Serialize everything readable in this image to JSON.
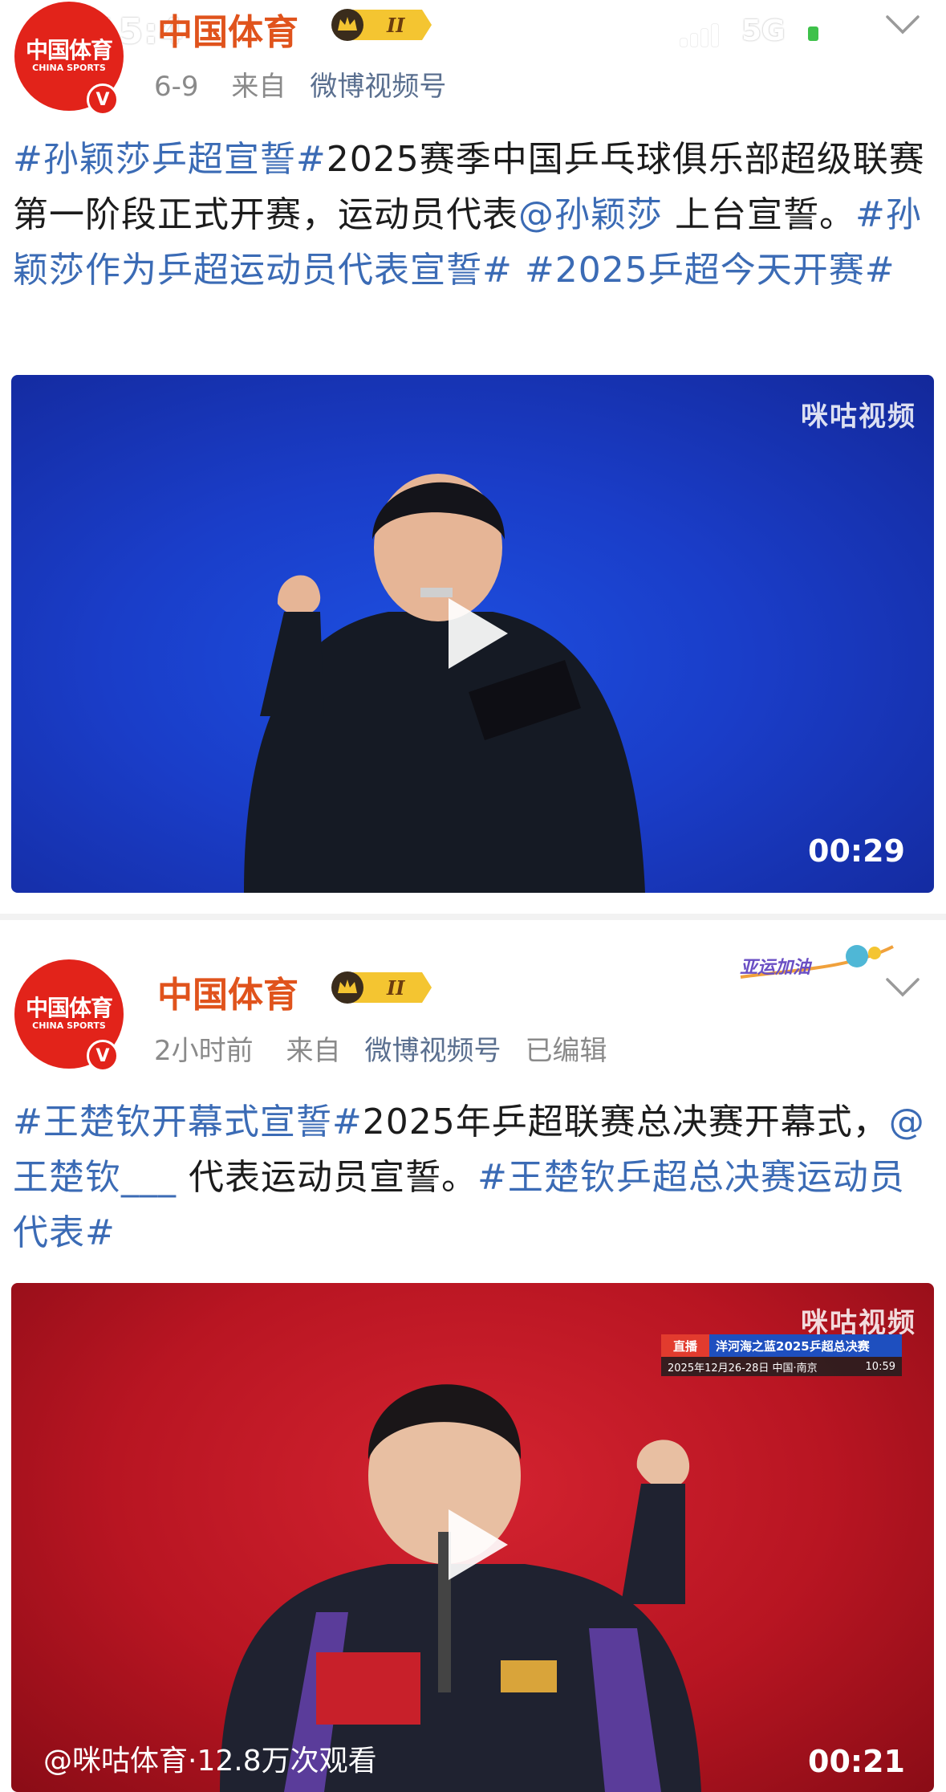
{
  "status_bar": {
    "time": "15:4",
    "network": "5G",
    "battery_level": 0.3
  },
  "posts": [
    {
      "account_name": "中国体育",
      "avatar_text": "中国体育",
      "avatar_subtext": "CHINA SPORTS",
      "vip_level": "II",
      "date": "6-9",
      "source_prefix": "来自",
      "source": "微博视频号",
      "edited": "",
      "text": {
        "tag1": "#孙颖莎乒超宣誓#",
        "body1": "2025赛季中国乒乓球俱乐部超级联赛第一阶段正式开赛，运动员代表",
        "mention": "@孙颖莎",
        "body2": " 上台宣誓。",
        "tag2": "#孙颖莎作为乒超运动员代表宣誓#",
        "tag3": " #2025乒超今天开赛#"
      },
      "video": {
        "watermark": "咪咕视频",
        "duration": "00:29"
      }
    },
    {
      "account_name": "中国体育",
      "avatar_text": "中国体育",
      "avatar_subtext": "CHINA SPORTS",
      "vip_level": "II",
      "date": "2小时前",
      "source_prefix": "来自",
      "source": "微博视频号",
      "edited": "已编辑",
      "sticker": "亚运加油",
      "text": {
        "tag1": "#王楚钦开幕式宣誓#",
        "body1": "2025年乒超联赛总决赛开幕式，",
        "mention": "@王楚钦___",
        "body2": " 代表运动员宣誓。",
        "tag2": "#王楚钦乒超总决赛运动员代表#"
      },
      "video": {
        "watermark": "咪咕视频",
        "duration": "00:21",
        "views_line": "@咪咕体育·12.8万次观看",
        "scoreboard": {
          "live": "直播",
          "title": "洋河海之蓝2025乒超总决赛",
          "dates": "2025年12月26-28日 中国·南京",
          "clock": "10:59"
        }
      }
    }
  ],
  "colors": {
    "brand_red": "#e2231a",
    "link_blue": "#3b6bb5",
    "username_orange": "#e0531c"
  }
}
